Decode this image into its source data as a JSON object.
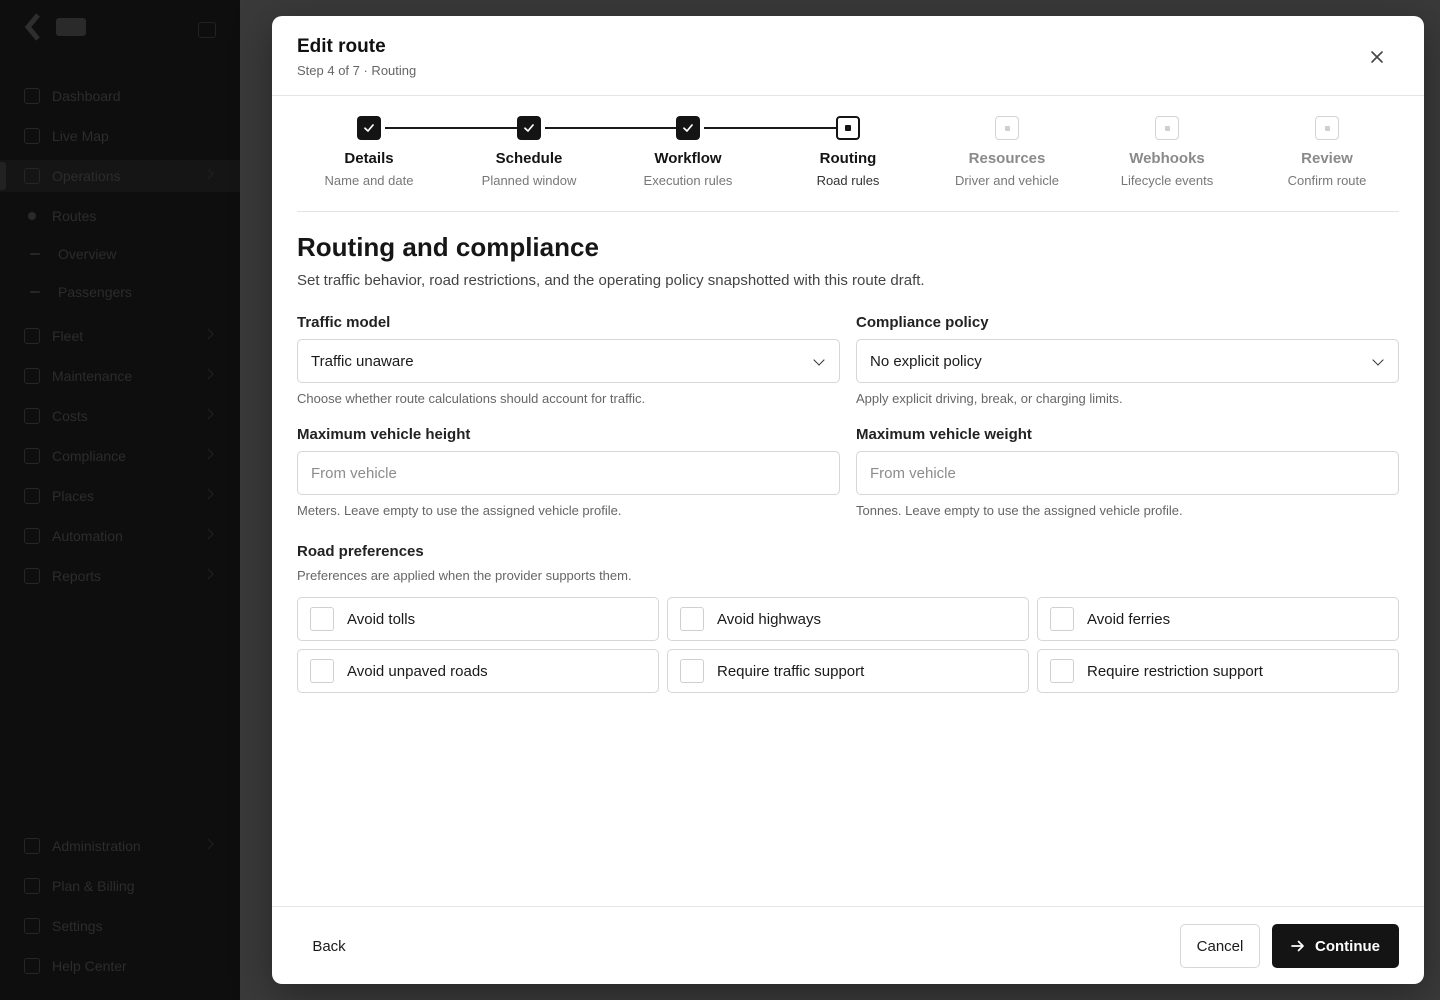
{
  "background_nav": {
    "items": [
      "Dashboard",
      "Live Map",
      "Operations",
      "Routes",
      "Overview",
      "Passengers",
      "Fleet",
      "Maintenance",
      "Costs",
      "Compliance",
      "Places",
      "Automation",
      "Reports",
      "Administration",
      "Plan & Billing",
      "Settings",
      "Help Center"
    ]
  },
  "modal": {
    "title": "Edit route",
    "subtitle": "Step 4 of 7 · Routing"
  },
  "stepper": {
    "steps": [
      {
        "label": "Details",
        "desc": "Name and date",
        "state": "done"
      },
      {
        "label": "Schedule",
        "desc": "Planned window",
        "state": "done"
      },
      {
        "label": "Workflow",
        "desc": "Execution rules",
        "state": "done"
      },
      {
        "label": "Routing",
        "desc": "Road rules",
        "state": "current"
      },
      {
        "label": "Resources",
        "desc": "Driver and vehicle",
        "state": "todo"
      },
      {
        "label": "Webhooks",
        "desc": "Lifecycle events",
        "state": "todo"
      },
      {
        "label": "Review",
        "desc": "Confirm route",
        "state": "todo"
      }
    ]
  },
  "section": {
    "title": "Routing and compliance",
    "description": "Set traffic behavior, road restrictions, and the operating policy snapshotted with this route draft."
  },
  "fields": {
    "traffic_model": {
      "label": "Traffic model",
      "value": "Traffic unaware",
      "help": "Choose whether route calculations should account for traffic."
    },
    "compliance_policy": {
      "label": "Compliance policy",
      "value": "No explicit policy",
      "help": "Apply explicit driving, break, or charging limits."
    },
    "max_height": {
      "label": "Maximum vehicle height",
      "placeholder": "From vehicle",
      "help": "Meters. Leave empty to use the assigned vehicle profile."
    },
    "max_weight": {
      "label": "Maximum vehicle weight",
      "placeholder": "From vehicle",
      "help": "Tonnes. Leave empty to use the assigned vehicle profile."
    }
  },
  "road_preferences": {
    "title": "Road preferences",
    "description": "Preferences are applied when the provider supports them.",
    "options": [
      {
        "label": "Avoid tolls",
        "checked": false
      },
      {
        "label": "Avoid highways",
        "checked": false
      },
      {
        "label": "Avoid ferries",
        "checked": false
      },
      {
        "label": "Avoid unpaved roads",
        "checked": false
      },
      {
        "label": "Require traffic support",
        "checked": false
      },
      {
        "label": "Require restriction support",
        "checked": false
      }
    ]
  },
  "footer": {
    "back_label": "Back",
    "cancel_label": "Cancel",
    "continue_label": "Continue"
  },
  "icons": {
    "close": "close-icon",
    "check": "check-icon",
    "chevron": "chevron-down-icon",
    "arrow": "arrow-right-icon"
  }
}
